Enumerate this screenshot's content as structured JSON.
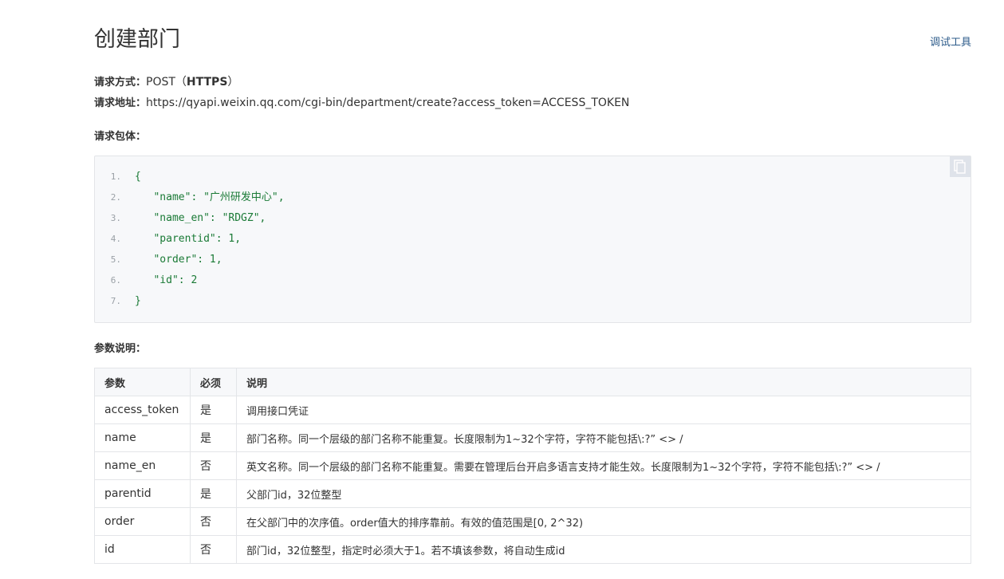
{
  "header": {
    "title": "创建部门",
    "debug_link": "调试工具"
  },
  "request": {
    "method_label": "请求方式：",
    "method_value": "POST（",
    "method_protocol": "HTTPS",
    "method_close": "）",
    "url_label": "请求地址：",
    "url_value": "https://qyapi.weixin.qq.com/cgi-bin/department/create?access_token=ACCESS_TOKEN"
  },
  "body_section": {
    "label": "请求包体：",
    "copy_icon": "copy-icon",
    "lines": [
      {
        "num": "1.",
        "text": "{"
      },
      {
        "num": "2.",
        "text": "   \"name\": \"广州研发中心\","
      },
      {
        "num": "3.",
        "text": "   \"name_en\": \"RDGZ\","
      },
      {
        "num": "4.",
        "text": "   \"parentid\": 1,"
      },
      {
        "num": "5.",
        "text": "   \"order\": 1,"
      },
      {
        "num": "6.",
        "text": "   \"id\": 2"
      },
      {
        "num": "7.",
        "text": "}"
      }
    ]
  },
  "params_section": {
    "label": "参数说明：",
    "headers": [
      "参数",
      "必须",
      "说明"
    ],
    "rows": [
      [
        "access_token",
        "是",
        "调用接口凭证"
      ],
      [
        "name",
        "是",
        "部门名称。同一个层级的部门名称不能重复。长度限制为1~32个字符，字符不能包括\\:?” <> /"
      ],
      [
        "name_en",
        "否",
        "英文名称。同一个层级的部门名称不能重复。需要在管理后台开启多语言支持才能生效。长度限制为1~32个字符，字符不能包括\\:?” <> /"
      ],
      [
        "parentid",
        "是",
        "父部门id，32位整型"
      ],
      [
        "order",
        "否",
        "在父部门中的次序值。order值大的排序靠前。有效的值范围是[0, 2^32)"
      ],
      [
        "id",
        "否",
        "部门id，32位整型，指定时必须大于1。若不填该参数，将自动生成id"
      ]
    ]
  }
}
